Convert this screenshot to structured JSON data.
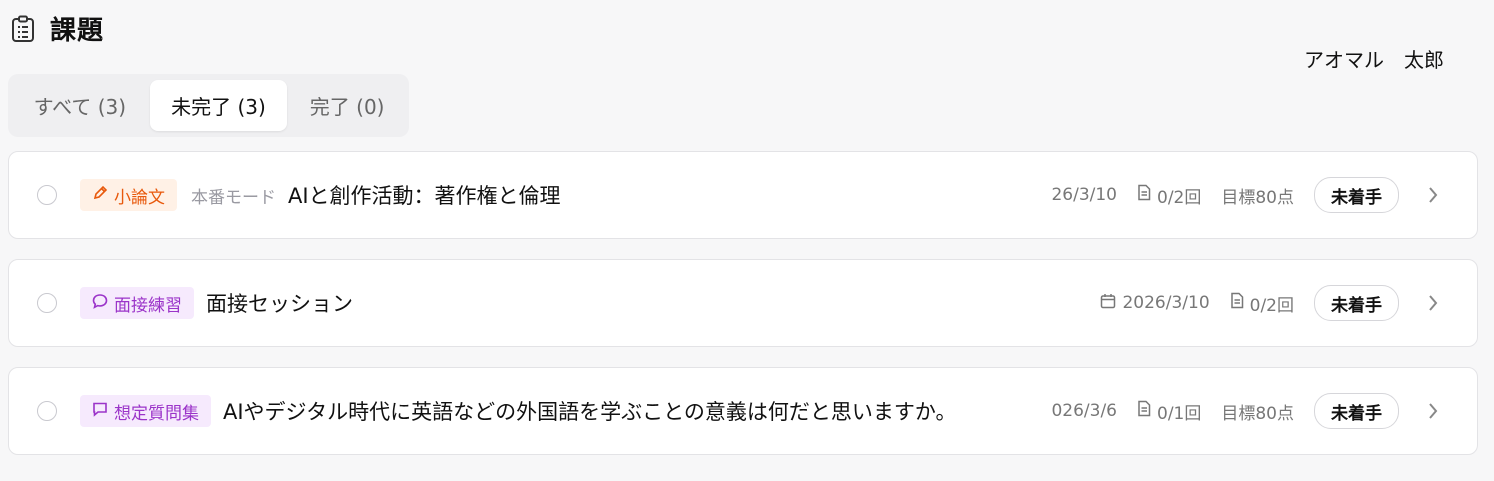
{
  "header": {
    "title": "課題",
    "icon": "clipboard-icon"
  },
  "user": {
    "name": "アオマル　太郎"
  },
  "tabs": [
    {
      "label": "すべて (3)",
      "active": false
    },
    {
      "label": "未完了 (3)",
      "active": true
    },
    {
      "label": "完了 (0)",
      "active": false
    }
  ],
  "tasks": [
    {
      "badge": {
        "label": "小論文",
        "icon": "pen-icon",
        "color": "#e8590c"
      },
      "mode": "本番モード",
      "title": "AIと創作活動：著作権と倫理",
      "date": "26/3/10",
      "attempts": "0/2回",
      "target": "目標80点",
      "status": "未着手"
    },
    {
      "badge": {
        "label": "面接練習",
        "icon": "speech-bubble-icon",
        "color": "#9b34c9"
      },
      "title": "面接セッション",
      "date": "2026/3/10",
      "attempts": "0/2回",
      "status": "未着手"
    },
    {
      "badge": {
        "label": "想定質問集",
        "icon": "chat-icon",
        "color": "#9b34c9"
      },
      "title": "AIやデジタル時代に英語などの外国語を学ぶことの意義は何だと思いますか。",
      "date": "026/3/6",
      "attempts": "0/1回",
      "target": "目標80点",
      "status": "未着手"
    }
  ]
}
